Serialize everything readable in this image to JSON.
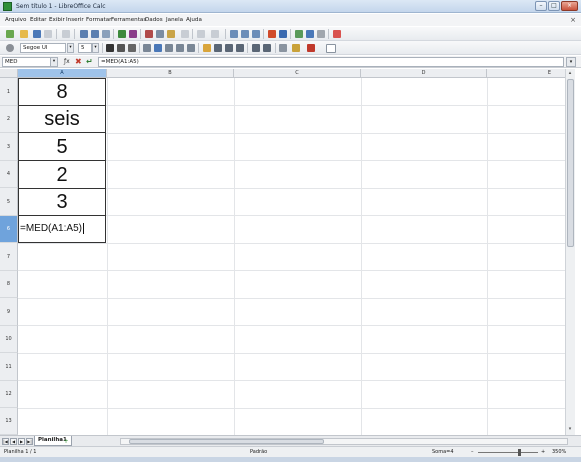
{
  "window": {
    "title": "Sem título 1 - LibreOffice Calc",
    "controls": [
      "–",
      "□",
      "×"
    ]
  },
  "menu": [
    "Arquivo",
    "Editar",
    "Exibir",
    "Inserir",
    "Formatar",
    "Ferramentas",
    "Dados",
    "Janela",
    "Ajuda"
  ],
  "menu_close": "×",
  "format_toolbar": {
    "font_name": "Segoe UI",
    "font_size": "5"
  },
  "formula_bar": {
    "name_box": "MED",
    "formula": "=MED(A1:A5)",
    "function_wizard_icon": "fx-icon",
    "cancel_icon": "cancel-icon",
    "accept_icon": "accept-icon"
  },
  "columns": [
    "A",
    "B",
    "C",
    "D",
    "E"
  ],
  "active_column": "A",
  "rows": [
    "1",
    "2",
    "3",
    "4",
    "5",
    "6",
    "7",
    "8",
    "9",
    "10",
    "11",
    "12",
    "13"
  ],
  "active_row": "6",
  "cells": {
    "A1": "8",
    "A2": "seis",
    "A3": "5",
    "A4": "2",
    "A5": "3",
    "A6": "=MED(A1:A5)"
  },
  "sheet_tabs": {
    "nav": [
      "|◀",
      "◀",
      "▶",
      "▶|"
    ],
    "active": "Planilha1",
    "add": "+"
  },
  "status": {
    "sheet": "Planilha 1 / 1",
    "style": "Padrão",
    "sum": "Soma=4",
    "zoom": "350%",
    "zoom_minus": "–",
    "zoom_plus": "+"
  },
  "colors": {
    "active_header": "#9fc3ea",
    "active_row_header": "#6fa3dc",
    "cell_border": "#333333"
  }
}
